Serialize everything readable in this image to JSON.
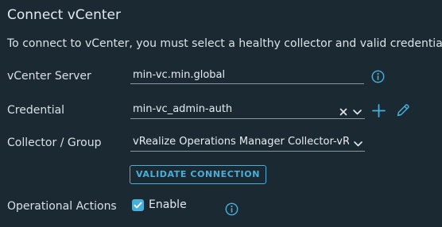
{
  "dialog": {
    "title": "Connect vCenter",
    "description": "To connect to vCenter, you must select a healthy collector and valid credentials."
  },
  "form": {
    "vcenter_server": {
      "label": "vCenter Server",
      "value": "min-vc.min.global",
      "icon": "info-icon"
    },
    "credential": {
      "label": "Credential",
      "value": "min-vc_admin-auth",
      "icons": [
        "clear-icon",
        "chevron-down-icon",
        "add-icon",
        "edit-icon"
      ]
    },
    "collector_group": {
      "label": "Collector / Group",
      "value": "vRealize Operations Manager Collector-vRops",
      "icon": "chevron-down-icon"
    },
    "validate_button": "VALIDATE CONNECTION",
    "operational_actions": {
      "label": "Operational Actions",
      "checkbox_label": "Enable",
      "checked": true,
      "icon": "info-icon"
    }
  },
  "colors": {
    "background": "#1b2a32",
    "accent": "#49afd9",
    "text": "#d6dfe4",
    "field_border": "#8a999f"
  }
}
